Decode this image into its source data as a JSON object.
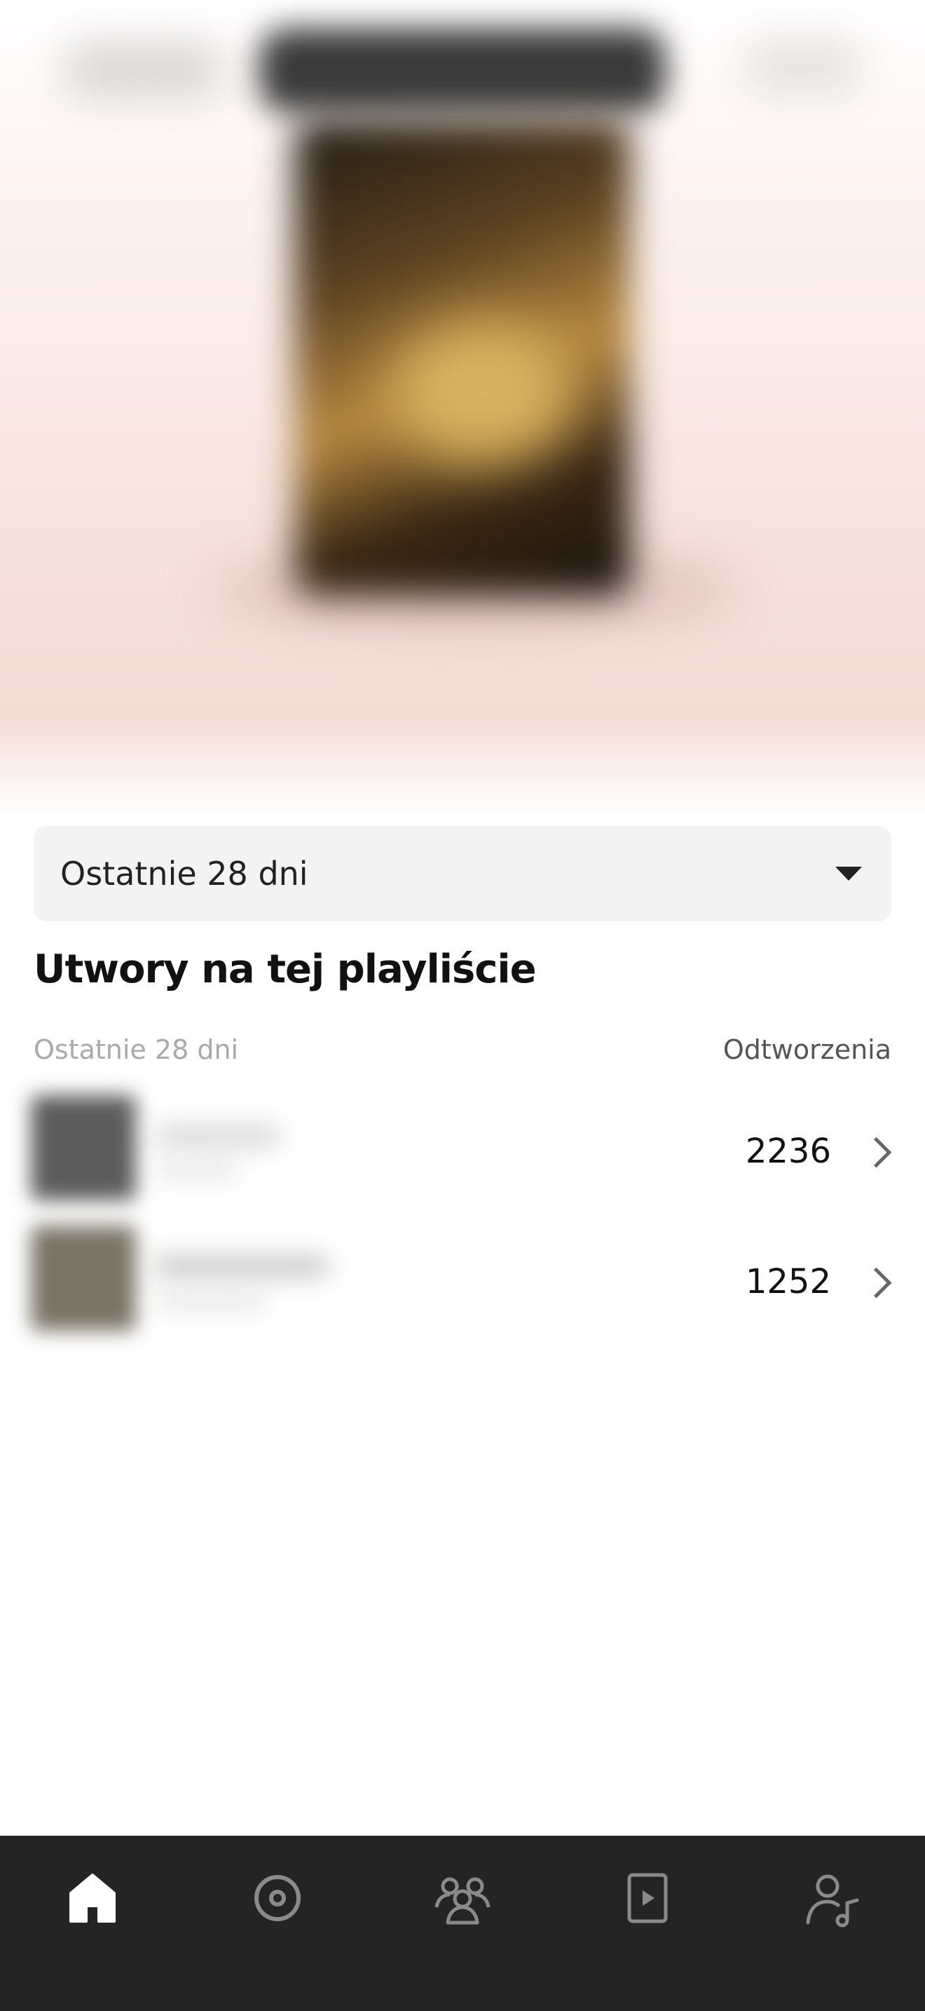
{
  "period_select": {
    "label": "Ostatnie 28 dni"
  },
  "section": {
    "title": "Utwory na tej playliście",
    "column_left": "Ostatnie 28 dni",
    "column_right": "Odtworzenia"
  },
  "tracks": [
    {
      "plays": "2236"
    },
    {
      "plays": "1252"
    }
  ],
  "bottom_nav": {
    "items": [
      {
        "icon": "home-icon",
        "active": true
      },
      {
        "icon": "disc-icon",
        "active": false
      },
      {
        "icon": "audience-icon",
        "active": false
      },
      {
        "icon": "video-icon",
        "active": false
      },
      {
        "icon": "artist-icon",
        "active": false
      }
    ]
  },
  "colors": {
    "nav_background": "#242424",
    "nav_active": "#ffffff",
    "nav_inactive": "#8a8a8a",
    "select_background": "#f3f3f3"
  }
}
